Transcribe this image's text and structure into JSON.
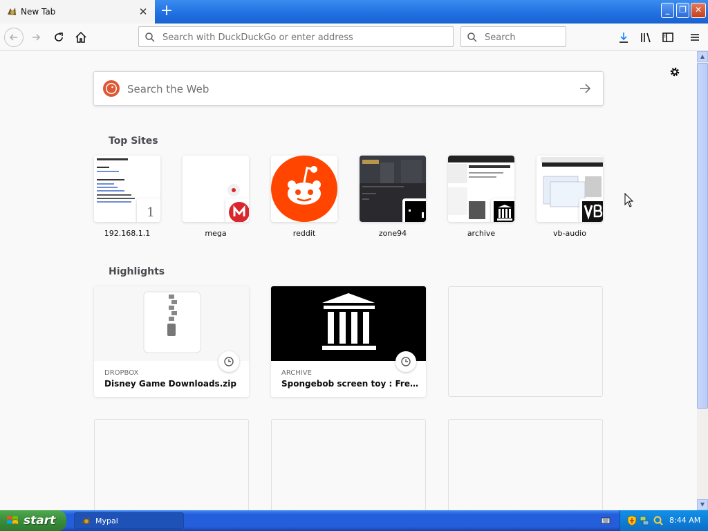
{
  "browser": {
    "tab": {
      "title": "New Tab"
    },
    "urlbar": {
      "placeholder": "Search with DuckDuckGo or enter address"
    },
    "searchbar": {
      "placeholder": "Search"
    }
  },
  "newtab": {
    "web_search": {
      "placeholder": "Search the Web"
    },
    "top_sites": {
      "heading": "Top Sites",
      "items": [
        {
          "label": "192.168.1.1",
          "badge": "1"
        },
        {
          "label": "mega"
        },
        {
          "label": "reddit"
        },
        {
          "label": "zone94"
        },
        {
          "label": "archive"
        },
        {
          "label": "vb-audio"
        }
      ]
    },
    "highlights": {
      "heading": "Highlights",
      "cards": [
        {
          "source": "DROPBOX",
          "title": "Disney Game Downloads.zip"
        },
        {
          "source": "ARCHIVE",
          "title": "Spongebob screen toy : Free Do..."
        }
      ]
    }
  },
  "taskbar": {
    "start_label": "start",
    "task_label": "Mypal",
    "clock": "8:44 AM"
  },
  "colors": {
    "reddit": "#ff4500",
    "mega": "#d9272e",
    "ddg": "#de5833",
    "taskbar": "#245edb",
    "start": "#3a8c3a"
  }
}
